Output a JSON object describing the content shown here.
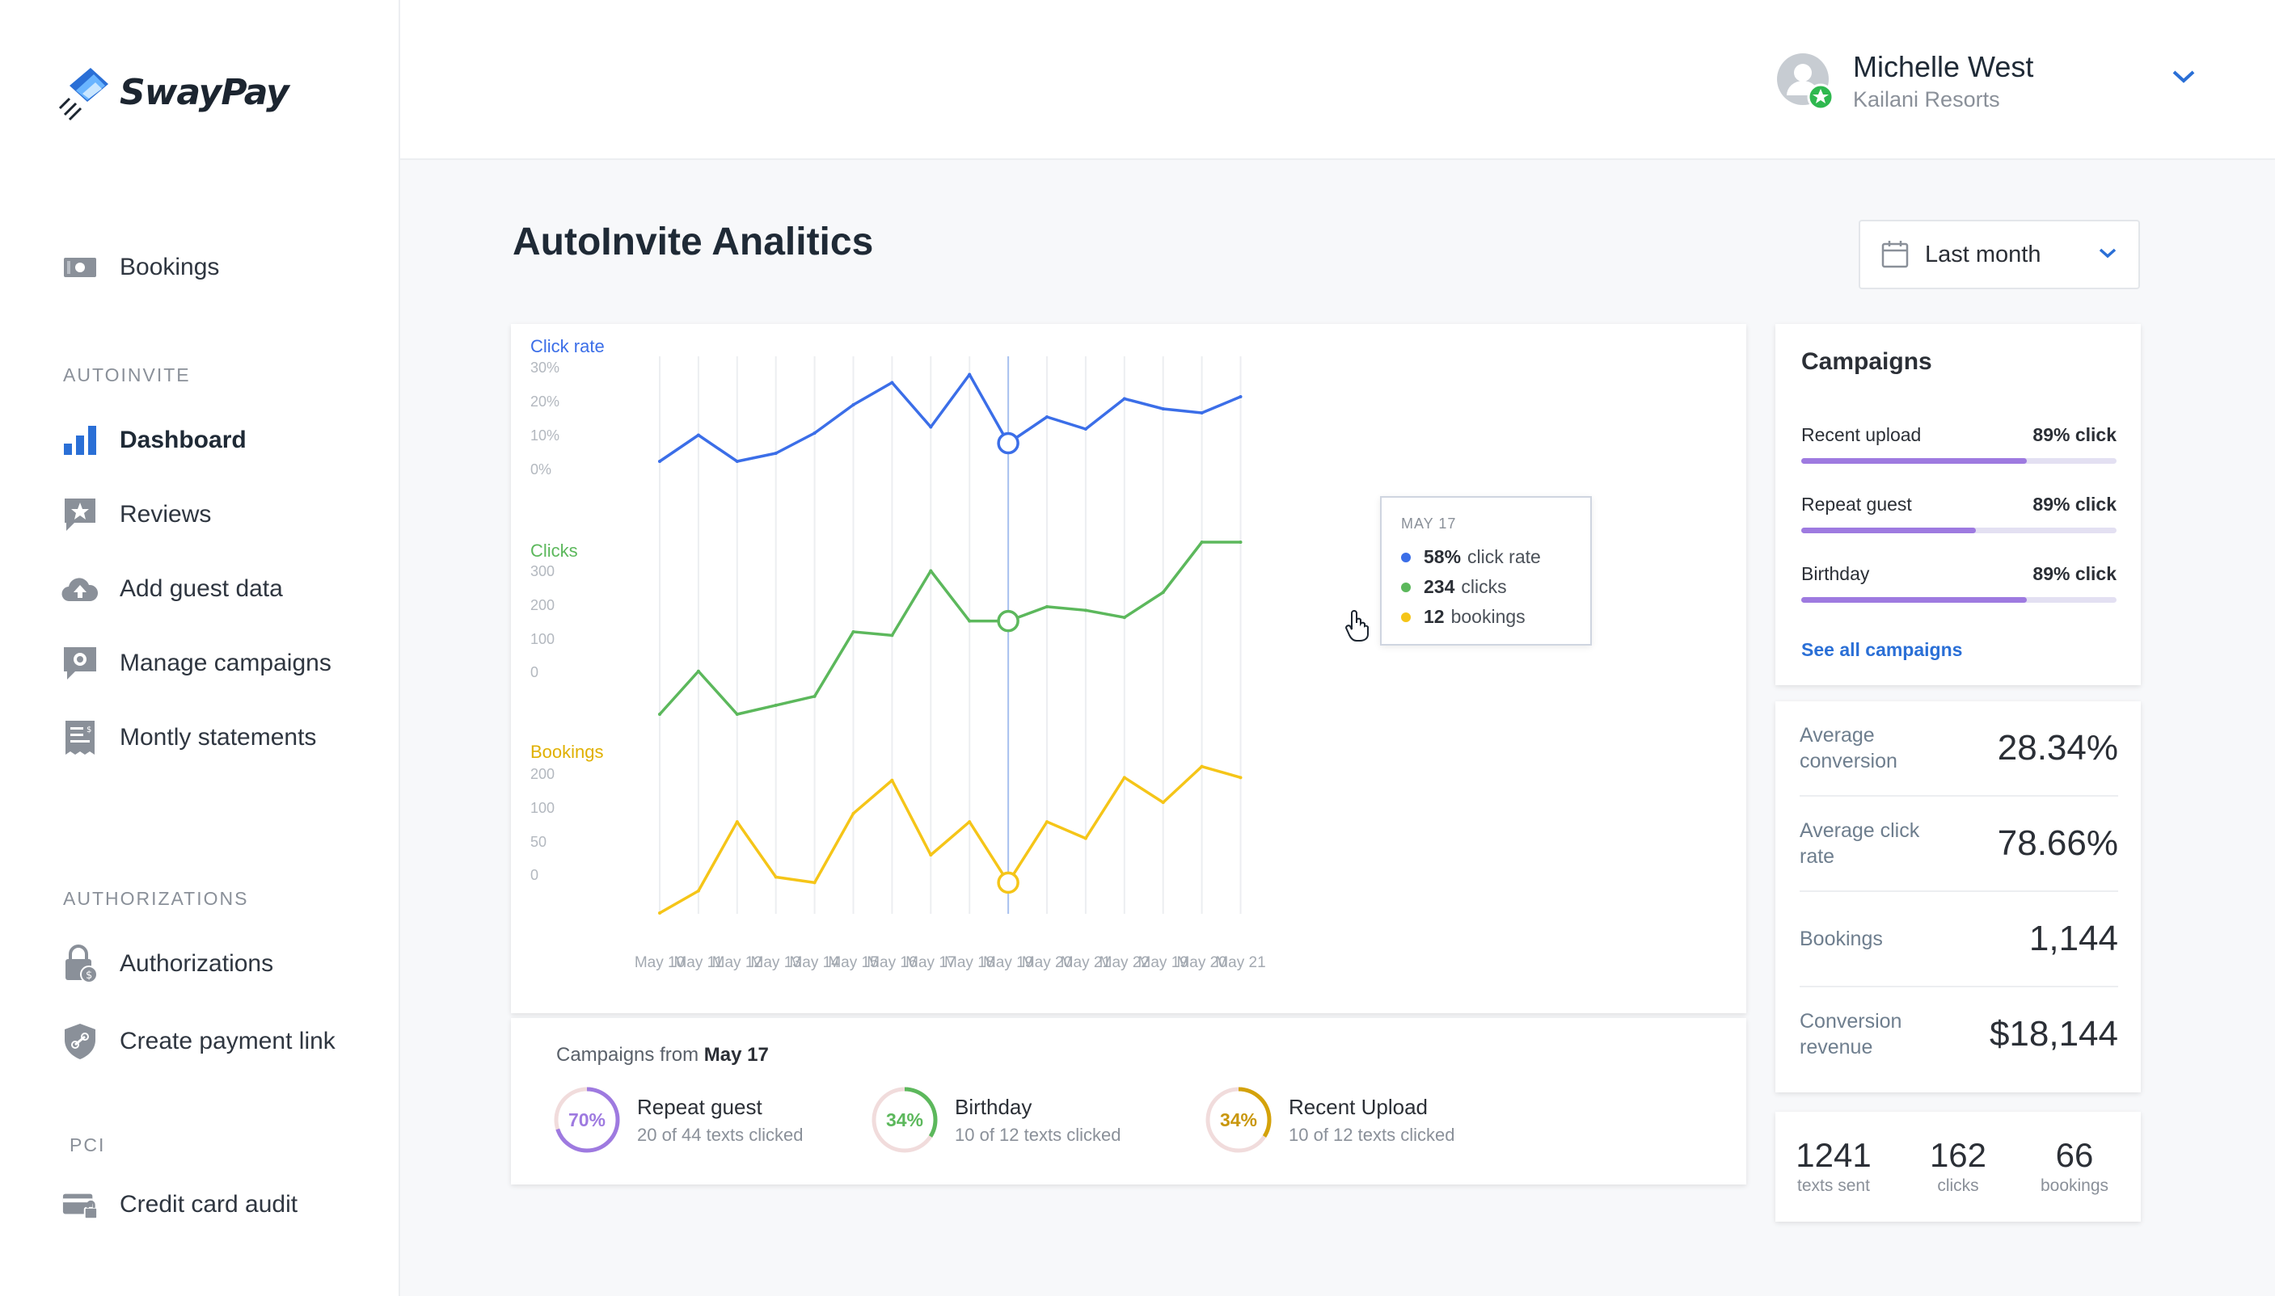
{
  "app": {
    "name": "SwayPay"
  },
  "sidebar": {
    "bookings": "Bookings",
    "sections": {
      "autoinvite": "AUTOINVITE",
      "authorizations": "AUTHORIZATIONS",
      "pci": "PCI"
    },
    "autoinvite_items": [
      "Dashboard",
      "Reviews",
      "Add guest data",
      "Manage campaigns",
      "Montly statements"
    ],
    "authorization_items": [
      "Authorizations",
      "Create payment link"
    ],
    "pci_items": [
      "Credit card audit"
    ]
  },
  "user": {
    "name": "Michelle West",
    "org": "Kailani Resorts"
  },
  "page": {
    "title": "AutoInvite Analitics",
    "date_range": "Last month"
  },
  "chart_data": {
    "type": "line",
    "x": [
      "May 10",
      "May 11",
      "May 12",
      "May 13",
      "May 14",
      "May 15",
      "May 16",
      "May 17",
      "May 18",
      "May 19",
      "May 20",
      "May 21",
      "May 22",
      "May 19",
      "May 20",
      "May 21"
    ],
    "panels": [
      {
        "name": "Click rate",
        "color": "#3b6ee8",
        "ticks": [
          "30%",
          "20%",
          "10%",
          "0%"
        ],
        "ylim": [
          0,
          30
        ],
        "values": [
          0,
          13,
          0,
          4,
          14,
          28,
          39,
          17,
          43,
          9,
          22,
          16,
          31,
          26,
          24,
          32
        ]
      },
      {
        "name": "Clicks",
        "color": "#5cb85c",
        "ticks": [
          "300",
          "200",
          "100",
          "0"
        ],
        "ylim": [
          0,
          300
        ],
        "values": [
          0,
          120,
          0,
          25,
          50,
          230,
          220,
          400,
          260,
          260,
          300,
          290,
          270,
          340,
          480,
          480
        ]
      },
      {
        "name": "Bookings",
        "color": "#f5c518",
        "ticks": [
          "200",
          "100",
          "50",
          "0"
        ],
        "ylim": [
          0,
          200
        ],
        "values": [
          0,
          40,
          165,
          65,
          55,
          180,
          240,
          105,
          165,
          55,
          165,
          135,
          245,
          200,
          265,
          245
        ]
      }
    ],
    "highlight_index": 9,
    "tooltip": {
      "date": "MAY 17",
      "rows": [
        {
          "value": "58%",
          "label": "click rate",
          "color": "#3b6ee8"
        },
        {
          "value": "234",
          "label": "clicks",
          "color": "#5cb85c"
        },
        {
          "value": "12",
          "label": "bookings",
          "color": "#f5c518"
        }
      ]
    }
  },
  "footer": {
    "prefix": "Campaigns from",
    "date": "May 17",
    "items": [
      {
        "pct_label": "70%",
        "pct": 70,
        "name": "Repeat guest",
        "sub": "20 of 44 texts clicked",
        "color": "#9e7ae0",
        "text_color": "#9e7ae0"
      },
      {
        "pct_label": "34%",
        "pct": 34,
        "name": "Birthday",
        "sub": "10 of 12 texts clicked",
        "color": "#5cb85c",
        "text_color": "#5cb85c"
      },
      {
        "pct_label": "34%",
        "pct": 34,
        "name": "Recent Upload",
        "sub": "10 of 12 texts clicked",
        "color": "#d4a20a",
        "text_color": "#c9970c"
      }
    ]
  },
  "campaigns": {
    "title": "Campaigns",
    "rows": [
      {
        "name": "Recent upload",
        "value": "89% click",
        "fill": 0.715
      },
      {
        "name": "Repeat guest",
        "value": "89% click",
        "fill": 0.555
      },
      {
        "name": "Birthday",
        "value": "89% click",
        "fill": 0.715
      }
    ],
    "see_all": "See all campaigns"
  },
  "stats": [
    {
      "label": "Average conversion",
      "value": "28.34%"
    },
    {
      "label": "Average click rate",
      "value": "78.66%"
    },
    {
      "label": "Bookings",
      "value": "1,144"
    },
    {
      "label": "Conversion revenue",
      "value": "$18,144"
    }
  ],
  "counts": [
    {
      "value": "1241",
      "label": "texts sent"
    },
    {
      "value": "162",
      "label": "clicks"
    },
    {
      "value": "66",
      "label": "bookings"
    }
  ]
}
